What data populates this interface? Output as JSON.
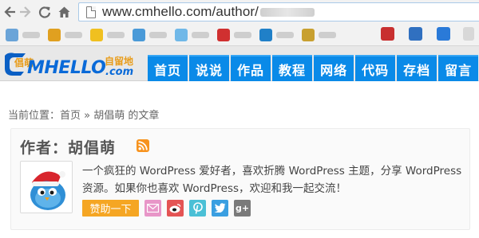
{
  "browser": {
    "url_visible": "www.cmhello.com/author/",
    "back_icon": "back-arrow-icon",
    "forward_icon": "forward-arrow-icon",
    "reload_icon": "reload-icon",
    "home_icon": "home-icon",
    "bookmark_colors": [
      "#6aa4d8",
      "#e0a020",
      "#f0c020",
      "#4a9ad8",
      "#70b8e8",
      "#d03030",
      "#2080c8",
      "#c8a030",
      "#c83030",
      "#3070c0",
      "#2a7ad8"
    ]
  },
  "site": {
    "logo_text": "CMHELLO",
    "logo_cn": "倡萌",
    "logo_sub": "自留地",
    "logo_com": ".com",
    "nav": [
      {
        "label": "首页"
      },
      {
        "label": "说说"
      },
      {
        "label": "作品"
      },
      {
        "label": "教程"
      },
      {
        "label": "网络"
      },
      {
        "label": "代码"
      },
      {
        "label": "存档"
      },
      {
        "label": "留言"
      }
    ],
    "accent_color": "#0a8ae8"
  },
  "breadcrumb": {
    "prefix": "当前位置：",
    "home": "首页",
    "sep": " » ",
    "current": "胡倡萌 的文章"
  },
  "author": {
    "title": "作者：胡倡萌",
    "bio": "一个疯狂的 WordPress 爱好者，喜欢折腾 WordPress 主题，分享 WordPress 资源。如果你也喜欢 WordPress，欢迎和我一起交流！",
    "support_label": "赞助一下",
    "social": [
      {
        "name": "mail-icon",
        "glyph": "✉"
      },
      {
        "name": "weibo-icon",
        "glyph": "微"
      },
      {
        "name": "pinterest-icon",
        "glyph": "P"
      },
      {
        "name": "twitter-icon",
        "glyph": "t"
      },
      {
        "name": "google-plus-icon",
        "glyph": "g+"
      }
    ]
  }
}
